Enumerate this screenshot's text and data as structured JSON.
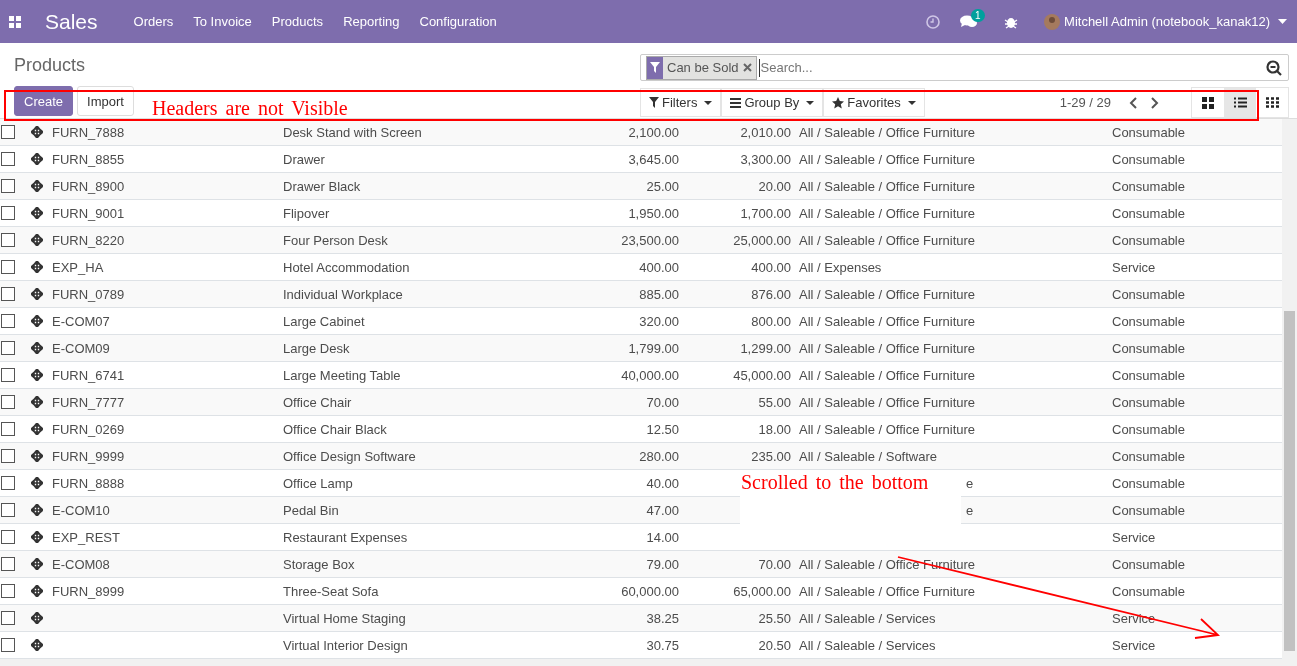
{
  "navbar": {
    "app": "Sales",
    "menu": [
      "Orders",
      "To Invoice",
      "Products",
      "Reporting",
      "Configuration"
    ],
    "messages_badge": "1",
    "user": "Mitchell Admin (notebook_kanak12)"
  },
  "breadcrumb": "Products",
  "search": {
    "facet": "Can be Sold",
    "placeholder": "Search..."
  },
  "buttons": [
    "Create",
    "Import"
  ],
  "search_options": [
    {
      "kind": "filter",
      "label": "Filters"
    },
    {
      "kind": "group",
      "label": "Group By"
    },
    {
      "kind": "favorite",
      "label": "Favorites"
    }
  ],
  "pager": "1-29 / 29",
  "views": [
    {
      "kind": "kanban",
      "selected": false
    },
    {
      "kind": "list",
      "selected": true
    },
    {
      "kind": "grid",
      "selected": false
    }
  ],
  "rows": [
    {
      "checked": false,
      "ref": "FURN_7888",
      "name": "Desk Stand with Screen",
      "price": "2,100.00",
      "cost": "2,010.00",
      "category": "All / Saleable / Office Furniture",
      "type": "Consumable"
    },
    {
      "checked": false,
      "ref": "FURN_8855",
      "name": "Drawer",
      "price": "3,645.00",
      "cost": "3,300.00",
      "category": "All / Saleable / Office Furniture",
      "type": "Consumable"
    },
    {
      "checked": false,
      "ref": "FURN_8900",
      "name": "Drawer Black",
      "price": "25.00",
      "cost": "20.00",
      "category": "All / Saleable / Office Furniture",
      "type": "Consumable"
    },
    {
      "checked": false,
      "ref": "FURN_9001",
      "name": "Flipover",
      "price": "1,950.00",
      "cost": "1,700.00",
      "category": "All / Saleable / Office Furniture",
      "type": "Consumable"
    },
    {
      "checked": false,
      "ref": "FURN_8220",
      "name": "Four Person Desk",
      "price": "23,500.00",
      "cost": "25,000.00",
      "category": "All / Saleable / Office Furniture",
      "type": "Consumable"
    },
    {
      "checked": false,
      "ref": "EXP_HA",
      "name": "Hotel Accommodation",
      "price": "400.00",
      "cost": "400.00",
      "category": "All / Expenses",
      "type": "Service"
    },
    {
      "checked": false,
      "ref": "FURN_0789",
      "name": "Individual Workplace",
      "price": "885.00",
      "cost": "876.00",
      "category": "All / Saleable / Office Furniture",
      "type": "Consumable"
    },
    {
      "checked": false,
      "ref": "E-COM07",
      "name": "Large Cabinet",
      "price": "320.00",
      "cost": "800.00",
      "category": "All / Saleable / Office Furniture",
      "type": "Consumable"
    },
    {
      "checked": false,
      "ref": "E-COM09",
      "name": "Large Desk",
      "price": "1,799.00",
      "cost": "1,299.00",
      "category": "All / Saleable / Office Furniture",
      "type": "Consumable"
    },
    {
      "checked": false,
      "ref": "FURN_6741",
      "name": "Large Meeting Table",
      "price": "40,000.00",
      "cost": "45,000.00",
      "category": "All / Saleable / Office Furniture",
      "type": "Consumable"
    },
    {
      "checked": false,
      "ref": "FURN_7777",
      "name": "Office Chair",
      "price": "70.00",
      "cost": "55.00",
      "category": "All / Saleable / Office Furniture",
      "type": "Consumable"
    },
    {
      "checked": false,
      "ref": "FURN_0269",
      "name": "Office Chair Black",
      "price": "12.50",
      "cost": "18.00",
      "category": "All / Saleable / Office Furniture",
      "type": "Consumable"
    },
    {
      "checked": false,
      "ref": "FURN_9999",
      "name": "Office Design Software",
      "price": "280.00",
      "cost": "235.00",
      "category": "All / Saleable / Software",
      "type": "Consumable"
    },
    {
      "checked": false,
      "ref": "FURN_8888",
      "name": "Office Lamp",
      "price": "40.00",
      "category_tail": "e",
      "type": "Consumable"
    },
    {
      "checked": false,
      "ref": "E-COM10",
      "name": "Pedal Bin",
      "price": "47.00",
      "category_tail": "e",
      "type": "Consumable"
    },
    {
      "checked": false,
      "ref": "EXP_REST",
      "name": "Restaurant Expenses",
      "price": "14.00",
      "type": "Service"
    },
    {
      "checked": false,
      "ref": "E-COM08",
      "name": "Storage Box",
      "price": "79.00",
      "cost": "70.00",
      "category": "All / Saleable / Office Furniture",
      "type": "Consumable"
    },
    {
      "checked": false,
      "ref": "FURN_8999",
      "name": "Three-Seat Sofa",
      "price": "60,000.00",
      "cost": "65,000.00",
      "category": "All / Saleable / Office Furniture",
      "type": "Consumable"
    },
    {
      "checked": false,
      "name": "Virtual Home Staging",
      "price": "38.25",
      "cost": "25.50",
      "category": "All / Saleable / Services",
      "type": "Service"
    },
    {
      "checked": false,
      "name": "Virtual Interior Design",
      "price": "30.75",
      "cost": "20.50",
      "category": "All / Saleable / Services",
      "type": "Service"
    }
  ],
  "annotations": {
    "header_note": "Headers are not Visible",
    "scroll_note": "Scrolled to the bottom"
  }
}
